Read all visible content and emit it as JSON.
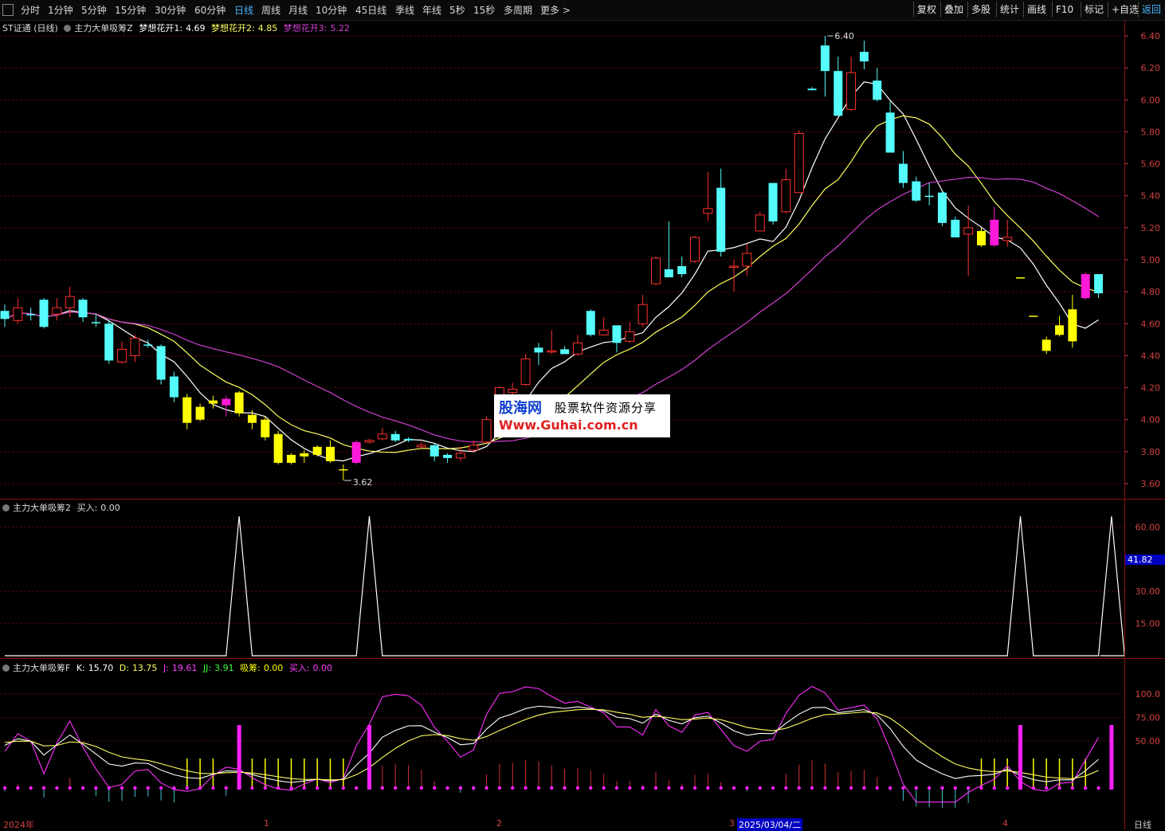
{
  "toolbar": {
    "periods": [
      "分时",
      "1分钟",
      "5分钟",
      "15分钟",
      "30分钟",
      "60分钟",
      "日线",
      "周线",
      "月线",
      "10分钟",
      "45日线",
      "季线",
      "年线",
      "5秒",
      "15秒",
      "多周期",
      "更多 >"
    ],
    "active": "日线",
    "right_buttons": [
      "复权",
      "叠加",
      "多股",
      "统计",
      "画线",
      "F10",
      "标记",
      "+自选",
      "返回"
    ]
  },
  "main": {
    "title": "ST证通 (日线)",
    "indicator": "主力大单吸筹Z",
    "ma1_label": "梦想花开1:",
    "ma1_value": "4.69",
    "ma2_label": "梦想花开2:",
    "ma2_value": "4.85",
    "ma3_label": "梦想花开3:",
    "ma3_value": "5.22",
    "high_label": "6.40",
    "low_label": "3.62",
    "y_ticks": [
      "6.40",
      "6.20",
      "6.00",
      "5.80",
      "5.60",
      "5.40",
      "5.20",
      "5.00",
      "4.80",
      "4.60",
      "4.40",
      "4.20",
      "4.00",
      "3.80",
      "3.60"
    ]
  },
  "sub1": {
    "title": "主力大单吸筹2",
    "buy_label": "买入:",
    "buy_value": "0.00",
    "y_ticks": [
      "60.00",
      "30.00",
      "15.00"
    ],
    "current_badge": "41.82",
    "chart_data": {
      "type": "line",
      "spikes_at_candle_index": [
        18,
        28,
        78,
        85
      ],
      "spike_value": 65,
      "baseline": 0
    }
  },
  "sub2": {
    "title": "主力大单吸筹F",
    "k_label": "K:",
    "k_value": "15.70",
    "d_label": "D:",
    "d_value": "13.75",
    "j_label": "J:",
    "j_value": "19.61",
    "jj_label": "JJ:",
    "jj_value": "3.91",
    "xc_label": "吸筹:",
    "xc_value": "0.00",
    "buy_label": "买入:",
    "buy_value": "0.00",
    "y_ticks": [
      "100.0",
      "75.00",
      "50.00"
    ]
  },
  "dates": {
    "year": "2024年",
    "m1": "1",
    "m2": "2",
    "m3": "3",
    "cursor": "2025/03/04/二",
    "m4": "4",
    "period": "日线"
  },
  "watermark": {
    "line1": "股海网",
    "line2": "股票软件资源分享",
    "line3": "Www.Guhai.com.cn"
  },
  "colors": {
    "up": "#ff3030",
    "down_cyan": "#54fcfc",
    "yellow": "#ffff00",
    "magenta": "#ff1ad9",
    "ma1": "#ffffff",
    "ma2": "#ffff60",
    "ma3": "#d040d0"
  },
  "chart_data": {
    "type": "candlestick",
    "ylim": [
      3.55,
      6.45
    ],
    "candles": [
      [
        4.68,
        4.63,
        4.72,
        4.58,
        "c"
      ],
      [
        4.62,
        4.7,
        4.76,
        4.6,
        "r"
      ],
      [
        4.66,
        4.66,
        4.7,
        4.62,
        "c"
      ],
      [
        4.75,
        4.58,
        4.76,
        4.57,
        "c"
      ],
      [
        4.66,
        4.7,
        4.76,
        4.62,
        "r"
      ],
      [
        4.7,
        4.77,
        4.83,
        4.64,
        "r"
      ],
      [
        4.75,
        4.64,
        4.76,
        4.61,
        "c"
      ],
      [
        4.61,
        4.61,
        4.66,
        4.58,
        "c"
      ],
      [
        4.6,
        4.37,
        4.62,
        4.35,
        "c"
      ],
      [
        4.36,
        4.44,
        4.49,
        4.35,
        "r"
      ],
      [
        4.4,
        4.51,
        4.53,
        4.36,
        "r"
      ],
      [
        4.47,
        4.47,
        4.5,
        4.45,
        "c"
      ],
      [
        4.46,
        4.25,
        4.47,
        4.22,
        "c"
      ],
      [
        4.27,
        4.14,
        4.3,
        4.11,
        "c"
      ],
      [
        4.14,
        3.98,
        4.16,
        3.94,
        "y"
      ],
      [
        4.08,
        4.0,
        4.1,
        3.99,
        "y"
      ],
      [
        4.12,
        4.1,
        4.15,
        4.07,
        "y"
      ],
      [
        4.13,
        4.09,
        4.15,
        4.02,
        "m"
      ],
      [
        4.17,
        4.04,
        4.18,
        4.02,
        "y"
      ],
      [
        4.03,
        3.98,
        4.06,
        3.94,
        "y"
      ],
      [
        4.0,
        3.89,
        4.02,
        3.87,
        "y"
      ],
      [
        3.91,
        3.73,
        3.93,
        3.72,
        "y"
      ],
      [
        3.78,
        3.73,
        3.79,
        3.72,
        "y"
      ],
      [
        3.79,
        3.77,
        3.81,
        3.73,
        "y"
      ],
      [
        3.83,
        3.78,
        3.84,
        3.77,
        "y"
      ],
      [
        3.83,
        3.74,
        3.87,
        3.73,
        "y"
      ],
      [
        3.69,
        3.69,
        3.72,
        3.62,
        "y"
      ],
      [
        3.73,
        3.86,
        3.87,
        3.72,
        "m"
      ],
      [
        3.86,
        3.87,
        3.88,
        3.85,
        "r"
      ],
      [
        3.88,
        3.91,
        3.95,
        3.87,
        "r"
      ],
      [
        3.91,
        3.87,
        3.93,
        3.86,
        "c"
      ],
      [
        3.88,
        3.87,
        3.89,
        3.86,
        "c"
      ],
      [
        3.83,
        3.84,
        3.86,
        3.82,
        "r"
      ],
      [
        3.84,
        3.77,
        3.85,
        3.74,
        "c"
      ],
      [
        3.78,
        3.76,
        3.79,
        3.73,
        "c"
      ],
      [
        3.76,
        3.79,
        3.83,
        3.74,
        "r"
      ],
      [
        3.81,
        3.84,
        3.87,
        3.8,
        "r"
      ],
      [
        3.86,
        4.0,
        4.02,
        3.85,
        "r"
      ],
      [
        4.13,
        4.2,
        4.21,
        4.12,
        "r"
      ],
      [
        4.19,
        4.17,
        4.23,
        4.14,
        "r"
      ],
      [
        4.22,
        4.38,
        4.41,
        4.21,
        "r"
      ],
      [
        4.45,
        4.42,
        4.48,
        4.34,
        "c"
      ],
      [
        4.43,
        4.43,
        4.56,
        4.41,
        "r"
      ],
      [
        4.44,
        4.41,
        4.46,
        4.41,
        "c"
      ],
      [
        4.41,
        4.48,
        4.53,
        4.4,
        "r"
      ],
      [
        4.68,
        4.53,
        4.69,
        4.52,
        "c"
      ],
      [
        4.53,
        4.56,
        4.64,
        4.53,
        "r"
      ],
      [
        4.59,
        4.48,
        4.59,
        4.42,
        "c"
      ],
      [
        4.49,
        4.55,
        4.61,
        4.48,
        "r"
      ],
      [
        4.72,
        4.6,
        4.78,
        4.58,
        "r"
      ],
      [
        4.85,
        5.01,
        5.02,
        4.84,
        "r"
      ],
      [
        4.94,
        4.89,
        5.24,
        4.89,
        "c"
      ],
      [
        4.96,
        4.91,
        5.02,
        4.89,
        "c"
      ],
      [
        4.99,
        5.14,
        5.15,
        4.98,
        "r"
      ],
      [
        5.29,
        5.32,
        5.55,
        5.24,
        "r"
      ],
      [
        5.45,
        5.05,
        5.57,
        5.02,
        "c"
      ],
      [
        4.96,
        4.96,
        5.0,
        4.8,
        "r"
      ],
      [
        4.96,
        5.04,
        5.1,
        4.9,
        "r"
      ],
      [
        5.18,
        5.28,
        5.3,
        5.18,
        "r"
      ],
      [
        5.48,
        5.24,
        5.48,
        5.22,
        "c"
      ],
      [
        5.3,
        5.5,
        5.57,
        5.29,
        "r"
      ],
      [
        5.42,
        5.79,
        5.81,
        5.42,
        "r"
      ],
      [
        6.06,
        6.07,
        6.08,
        6.06,
        "c"
      ],
      [
        6.34,
        6.18,
        6.4,
        6.02,
        "c"
      ],
      [
        6.18,
        5.9,
        6.27,
        5.9,
        "c"
      ],
      [
        5.94,
        6.17,
        6.27,
        5.93,
        "r"
      ],
      [
        6.3,
        6.24,
        6.37,
        6.19,
        "c"
      ],
      [
        6.12,
        6.0,
        6.2,
        5.99,
        "c"
      ],
      [
        5.92,
        5.67,
        5.99,
        5.67,
        "c"
      ],
      [
        5.6,
        5.48,
        5.68,
        5.45,
        "c"
      ],
      [
        5.49,
        5.37,
        5.52,
        5.36,
        "c"
      ],
      [
        5.4,
        5.4,
        5.48,
        5.34,
        "c"
      ],
      [
        5.42,
        5.23,
        5.43,
        5.21,
        "c"
      ],
      [
        5.25,
        5.14,
        5.27,
        5.14,
        "c"
      ],
      [
        5.2,
        5.16,
        5.34,
        4.9,
        "r"
      ],
      [
        5.18,
        5.09,
        5.2,
        5.08,
        "y"
      ],
      [
        5.25,
        5.09,
        5.33,
        5.08,
        "m"
      ],
      [
        5.12,
        5.14,
        5.25,
        5.08,
        "r"
      ],
      [
        4.89,
        4.89,
        4.89,
        4.89,
        "y"
      ],
      [
        4.65,
        4.65,
        4.65,
        4.65,
        "y"
      ],
      [
        4.5,
        4.43,
        4.52,
        4.41,
        "y"
      ],
      [
        4.59,
        4.53,
        4.65,
        4.52,
        "y"
      ],
      [
        4.69,
        4.49,
        4.78,
        4.45,
        "y"
      ],
      [
        4.91,
        4.76,
        4.92,
        4.75,
        "m"
      ],
      [
        4.79,
        4.91,
        4.91,
        4.76,
        "c"
      ]
    ]
  }
}
